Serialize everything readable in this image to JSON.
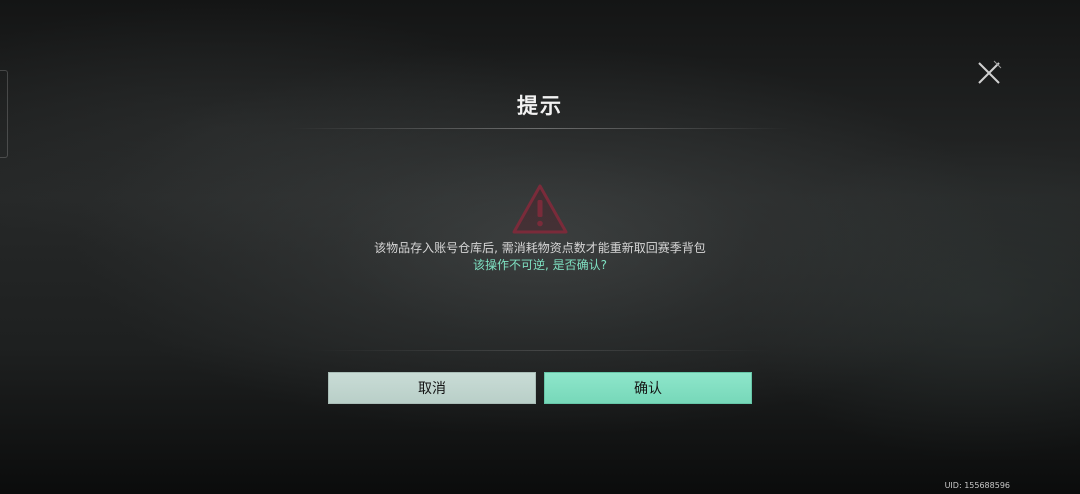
{
  "dialog": {
    "title": "提示",
    "message_line1": "该物品存入账号仓库后, 需消耗物资点数才能重新取回赛季背包",
    "message_line2": "该操作不可逆, 是否确认?",
    "cancel_label": "取消",
    "confirm_label": "确认"
  },
  "footer": {
    "uid": "UID: 155688596"
  },
  "icons": {
    "close": "close-icon",
    "warning": "warning-icon"
  },
  "colors": {
    "accent": "#7fe1c2",
    "confirm_button": "#83e0c3",
    "cancel_button": "#c3d8d1",
    "warning": "#7a2b3a"
  }
}
